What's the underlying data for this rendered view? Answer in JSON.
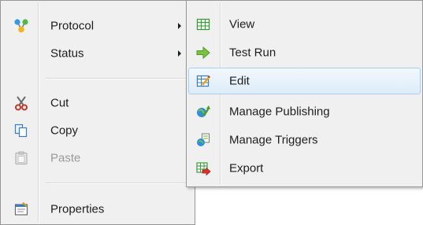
{
  "main_menu": {
    "items": [
      {
        "label": "Protocol",
        "icon": "protocol-icon"
      },
      {
        "label": "Status"
      },
      {
        "label": "Cut",
        "icon": "scissors-icon"
      },
      {
        "label": "Copy",
        "icon": "copy-icon"
      },
      {
        "label": "Paste",
        "icon": "paste-icon",
        "disabled": true
      },
      {
        "label": "Properties",
        "icon": "properties-icon"
      }
    ]
  },
  "sub_menu": {
    "items": [
      {
        "label": "View",
        "icon": "grid-view-icon"
      },
      {
        "label": "Test Run",
        "icon": "arrow-right-icon"
      },
      {
        "label": "Edit",
        "icon": "edit-table-icon",
        "highlighted": true
      },
      {
        "label": "Manage Publishing",
        "icon": "publishing-icon"
      },
      {
        "label": "Manage Triggers",
        "icon": "triggers-icon"
      },
      {
        "label": "Export",
        "icon": "export-icon"
      }
    ]
  },
  "colors": {
    "menu_bg": "#f0f0f0",
    "highlight_border": "#a8d0f2",
    "text": "#1e1e1e",
    "disabled_text": "#9a9a9a"
  }
}
